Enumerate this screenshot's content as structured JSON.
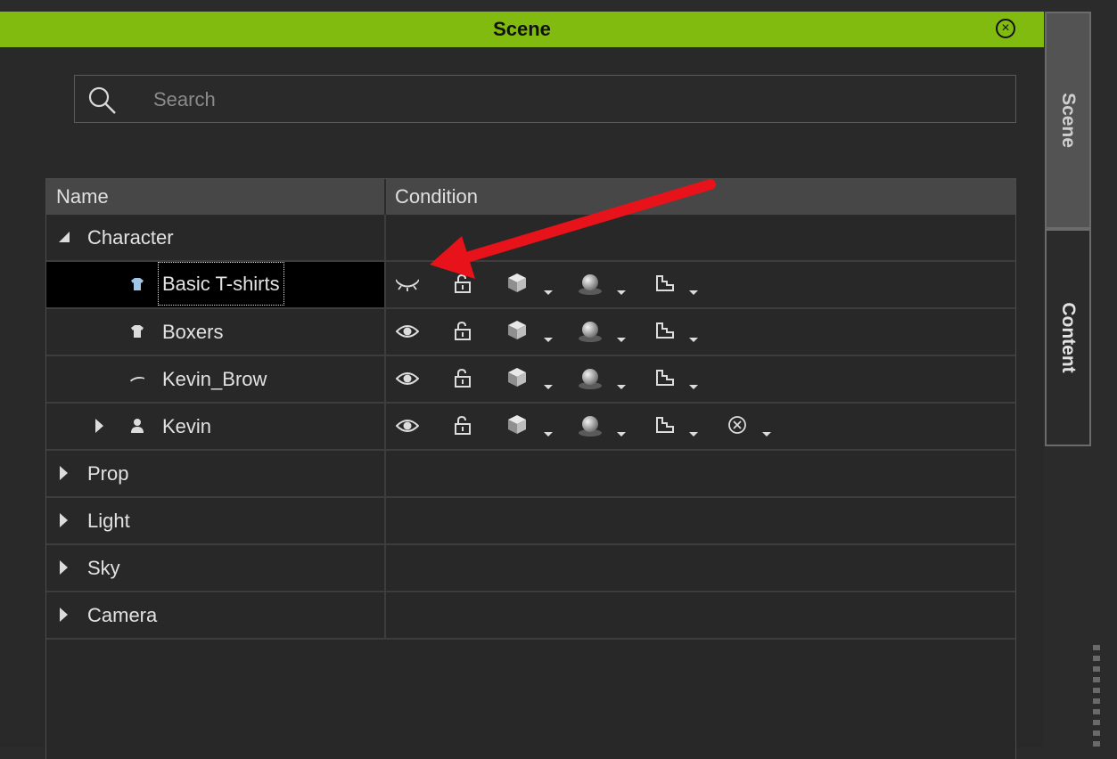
{
  "panel": {
    "title": "Scene",
    "close_icon": "close-circle-icon",
    "title_bar_color": "#82bb10"
  },
  "search": {
    "placeholder": "Search",
    "icon": "search-icon"
  },
  "table": {
    "columns": [
      "Name",
      "Condition"
    ],
    "rows": [
      {
        "label": "Character",
        "expander": "expanded",
        "level": 0,
        "icon": null,
        "conditions": false
      },
      {
        "label": "Basic T-shirts",
        "expander": null,
        "level": 2,
        "icon": "tshirt-icon",
        "selected": true,
        "visibility": "hidden",
        "conditions": true
      },
      {
        "label": "Boxers",
        "expander": null,
        "level": 2,
        "icon": "tshirt-icon",
        "visibility": "visible",
        "conditions": true
      },
      {
        "label": "Kevin_Brow",
        "expander": null,
        "level": 2,
        "icon": "brow-icon",
        "visibility": "visible",
        "conditions": true
      },
      {
        "label": "Kevin",
        "expander": "collapsed",
        "level": 1,
        "icon": "person-icon",
        "visibility": "visible",
        "conditions": true,
        "extra_condition": true
      },
      {
        "label": "Prop",
        "expander": "collapsed",
        "level": 0
      },
      {
        "label": "Light",
        "expander": "collapsed",
        "level": 0
      },
      {
        "label": "Sky",
        "expander": "collapsed",
        "level": 0
      },
      {
        "label": "Camera",
        "expander": "collapsed",
        "level": 0
      }
    ]
  },
  "side_tabs": {
    "scene": "Scene",
    "content": "Content"
  },
  "annotation": {
    "arrow_color": "#e8121b",
    "points_to": "hidden-eye-icon"
  }
}
